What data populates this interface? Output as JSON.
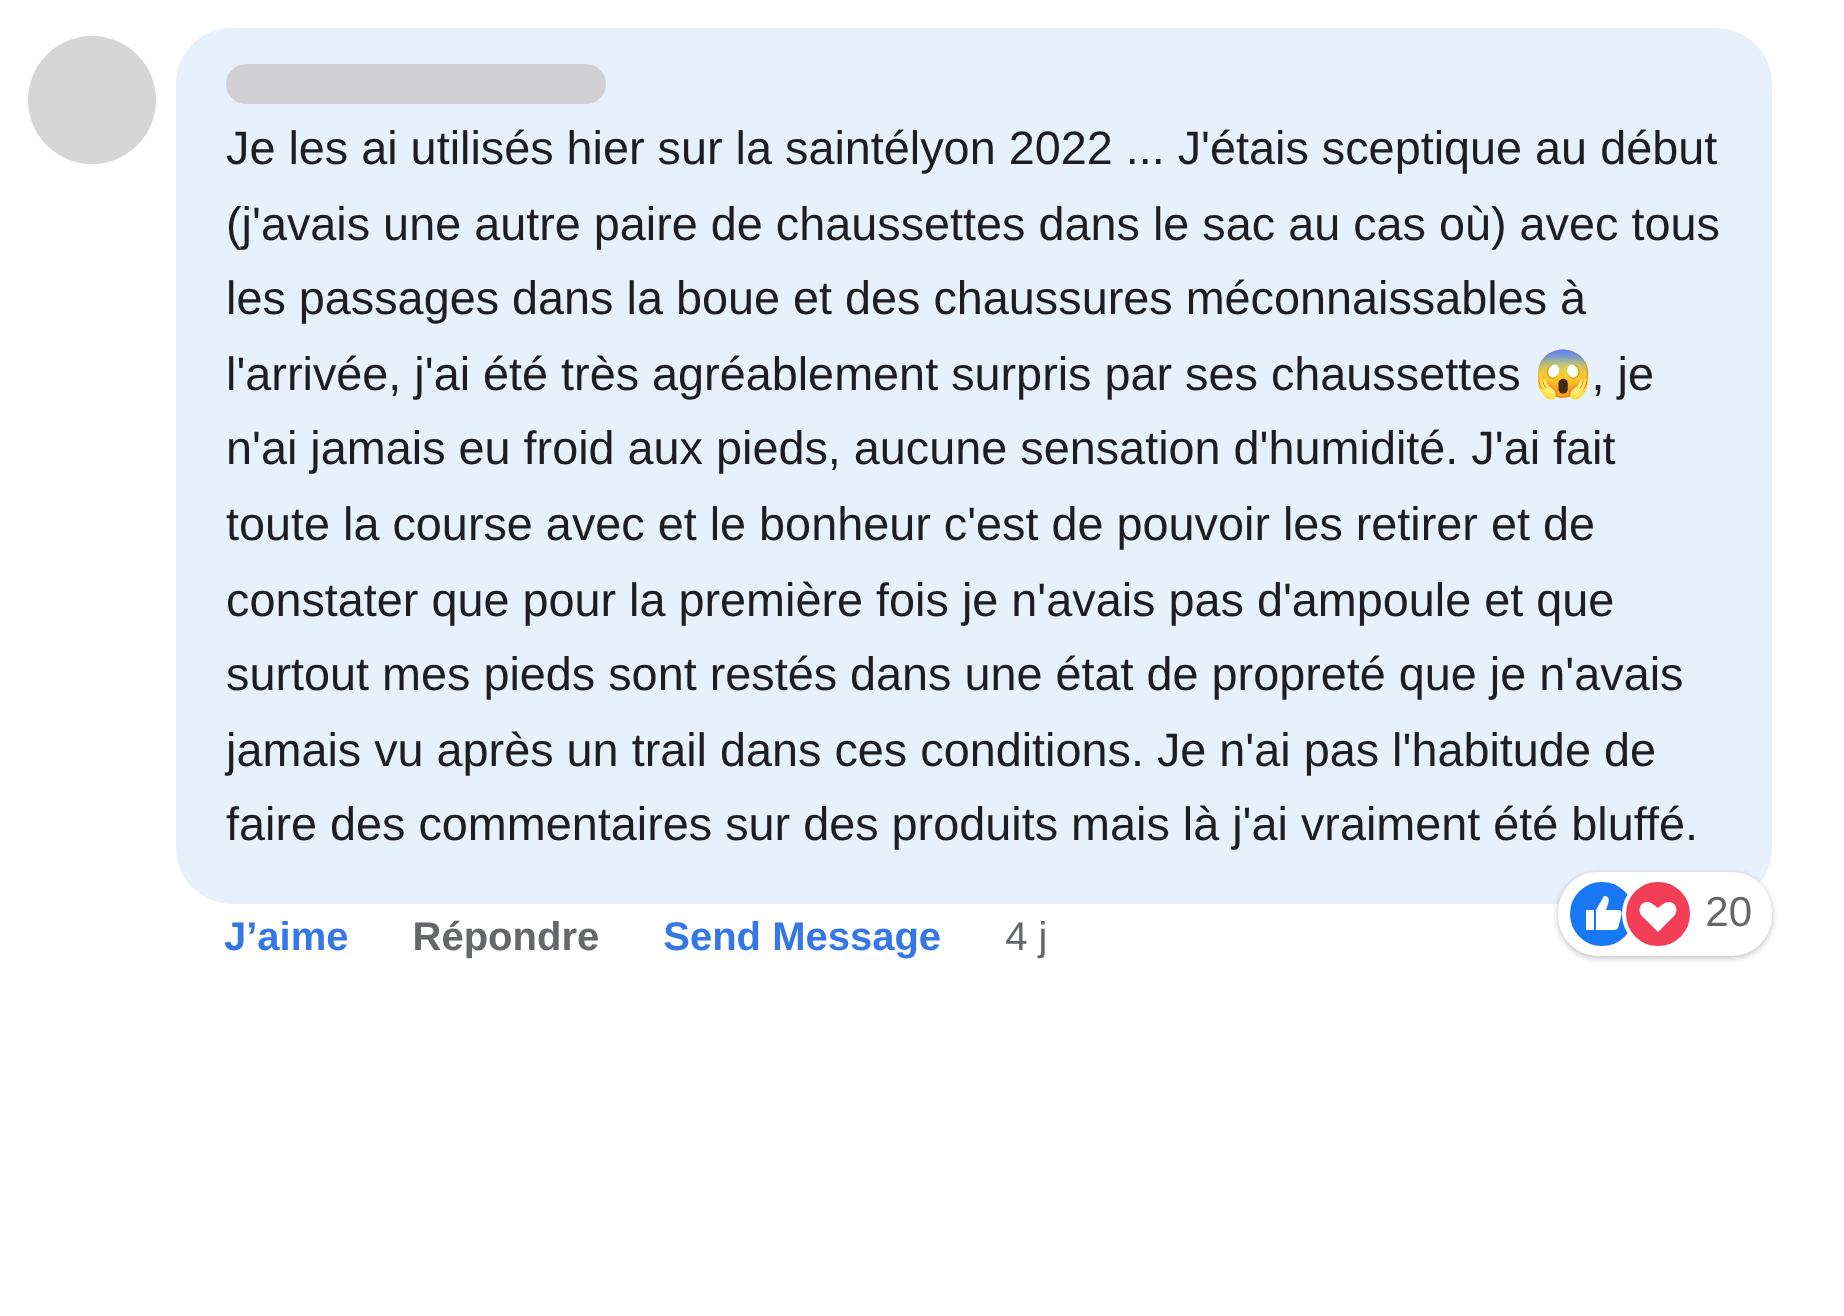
{
  "comment": {
    "author_redacted": true,
    "text": "Je les ai utilisés hier sur la saintélyon 2022 ... J'étais sceptique au début (j'avais une autre paire de chaussettes dans le sac au cas où) avec tous les passages dans la boue et des chaussures méconnaissables à l'arrivée, j'ai été très agréablement surpris par ses chaussettes 😱, je n'ai jamais eu froid aux pieds, aucune sensation d'humidité. J'ai fait toute la course avec et le bonheur c'est de pouvoir les retirer et de constater que pour la première fois je n'avais pas d'ampoule et que surtout mes pieds sont restés dans une état de propreté que je n'avais jamais vu après un trail dans ces conditions. Je n'ai pas l'habitude de faire des commentaires sur des produits mais là j'ai vraiment été bluffé.",
    "reactions": {
      "count": "20"
    },
    "actions": [
      {
        "label": "J’aime",
        "kind": "like",
        "liked": true
      },
      {
        "label": "Répondre",
        "kind": "reply"
      },
      {
        "label": "Send Message",
        "kind": "link"
      }
    ],
    "time": "4 j"
  }
}
